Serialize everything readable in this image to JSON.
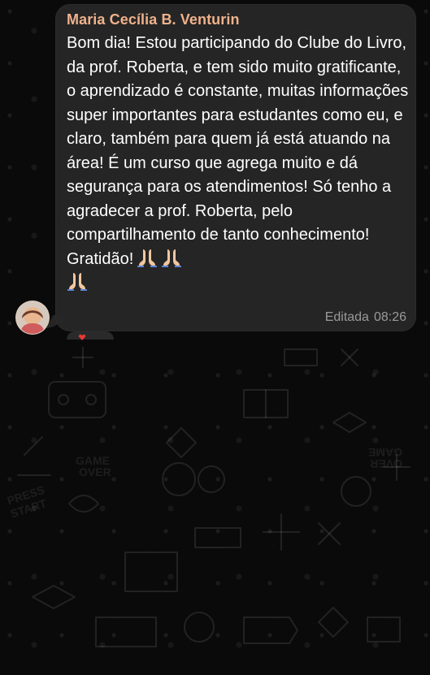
{
  "chat": {
    "sender_name": "Maria Cecília B. Venturin",
    "message": "Bom dia! Estou participando do Clube do Livro, da prof. Roberta, e tem sido muito gratificante, o aprendizado é constante, muitas informações super importantes para estudantes como eu, e claro, também para quem já está atuando na área! É um curso que agrega muito e dá segurança para os atendimentos! Só tenho a agradecer a prof. Roberta, pelo compartilhamento de tanto conhecimento! Gratidão!",
    "edited_label": "Editada",
    "time": "08:26"
  },
  "icons": {
    "praying_hands": "praying-hands-emoji",
    "reaction": "heart-icon",
    "avatar": "profile-photo"
  },
  "colors": {
    "background": "#0a0a0a",
    "bubble": "#262626",
    "sender_name": "#f0b28b",
    "message_text": "#ffffff",
    "meta_text": "#9a9a9a",
    "reaction": "#e53935"
  }
}
